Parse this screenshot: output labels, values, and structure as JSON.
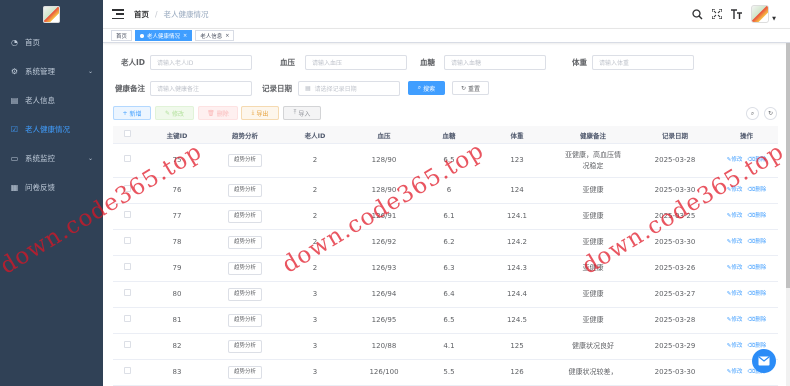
{
  "sidebar": {
    "items": [
      {
        "label": "首页",
        "icon": "dashboard-icon"
      },
      {
        "label": "系统管理",
        "icon": "gear-icon",
        "has_children": true
      },
      {
        "label": "老人信息",
        "icon": "doc-icon"
      },
      {
        "label": "老人健康情况",
        "icon": "check-square-icon",
        "active": true
      },
      {
        "label": "系统监控",
        "icon": "monitor-icon",
        "has_children": true
      },
      {
        "label": "问卷反馈",
        "icon": "grid-icon"
      }
    ]
  },
  "navbar": {
    "breadcrumb_home": "首页",
    "breadcrumb_current": "老人健康情况"
  },
  "tags": {
    "home": "首页",
    "active": "老人健康情况",
    "other": "老人信息"
  },
  "search": {
    "elder_id_label": "老人ID",
    "elder_id_placeholder": "请输入老人ID",
    "bp_label": "血压",
    "bp_placeholder": "请输入血压",
    "sugar_label": "血糖",
    "sugar_placeholder": "请输入血糖",
    "weight_label": "体重",
    "weight_placeholder": "请输入体重",
    "note_label": "健康备注",
    "note_placeholder": "请输入健康备注",
    "date_label": "记录日期",
    "date_placeholder": "请选择记录日期",
    "search_btn": "搜索",
    "reset_btn": "重置"
  },
  "toolbar": {
    "add": "新增",
    "edit": "修改",
    "delete": "删除",
    "export": "导出",
    "import": "导入"
  },
  "table": {
    "headers": [
      "主键ID",
      "趋势分析",
      "老人ID",
      "血压",
      "血糖",
      "体重",
      "健康备注",
      "记录日期",
      "操作"
    ],
    "trend_btn": "趋势分析",
    "op_edit": "修改",
    "op_delete": "删除",
    "rows": [
      {
        "id": "75",
        "elder": "2",
        "bp": "128/90",
        "sugar": "6.5",
        "weight": "123",
        "note": "亚健康，高血压情况稳定",
        "date": "2025-03-28"
      },
      {
        "id": "76",
        "elder": "2",
        "bp": "128/90",
        "sugar": "6",
        "weight": "124",
        "note": "亚健康",
        "date": "2025-03-30"
      },
      {
        "id": "77",
        "elder": "2",
        "bp": "126/91",
        "sugar": "6.1",
        "weight": "124.1",
        "note": "亚健康",
        "date": "2025-03-25"
      },
      {
        "id": "78",
        "elder": "2",
        "bp": "126/92",
        "sugar": "6.2",
        "weight": "124.2",
        "note": "亚健康",
        "date": "2025-03-30"
      },
      {
        "id": "79",
        "elder": "2",
        "bp": "126/93",
        "sugar": "6.3",
        "weight": "124.3",
        "note": "亚健康",
        "date": "2025-03-26"
      },
      {
        "id": "80",
        "elder": "3",
        "bp": "126/94",
        "sugar": "6.4",
        "weight": "124.4",
        "note": "亚健康",
        "date": "2025-03-27"
      },
      {
        "id": "81",
        "elder": "3",
        "bp": "126/95",
        "sugar": "6.5",
        "weight": "124.5",
        "note": "亚健康",
        "date": "2025-03-28"
      },
      {
        "id": "82",
        "elder": "3",
        "bp": "120/88",
        "sugar": "4.1",
        "weight": "125",
        "note": "健康状况良好",
        "date": "2025-03-29"
      },
      {
        "id": "83",
        "elder": "3",
        "bp": "126/100",
        "sugar": "5.5",
        "weight": "126",
        "note": "健康状况较差，",
        "date": "2025-03-30"
      }
    ]
  },
  "watermark": "down.code365.top",
  "colors": {
    "sidebar_bg": "#304156",
    "primary": "#409eff",
    "watermark": "#e11423"
  }
}
